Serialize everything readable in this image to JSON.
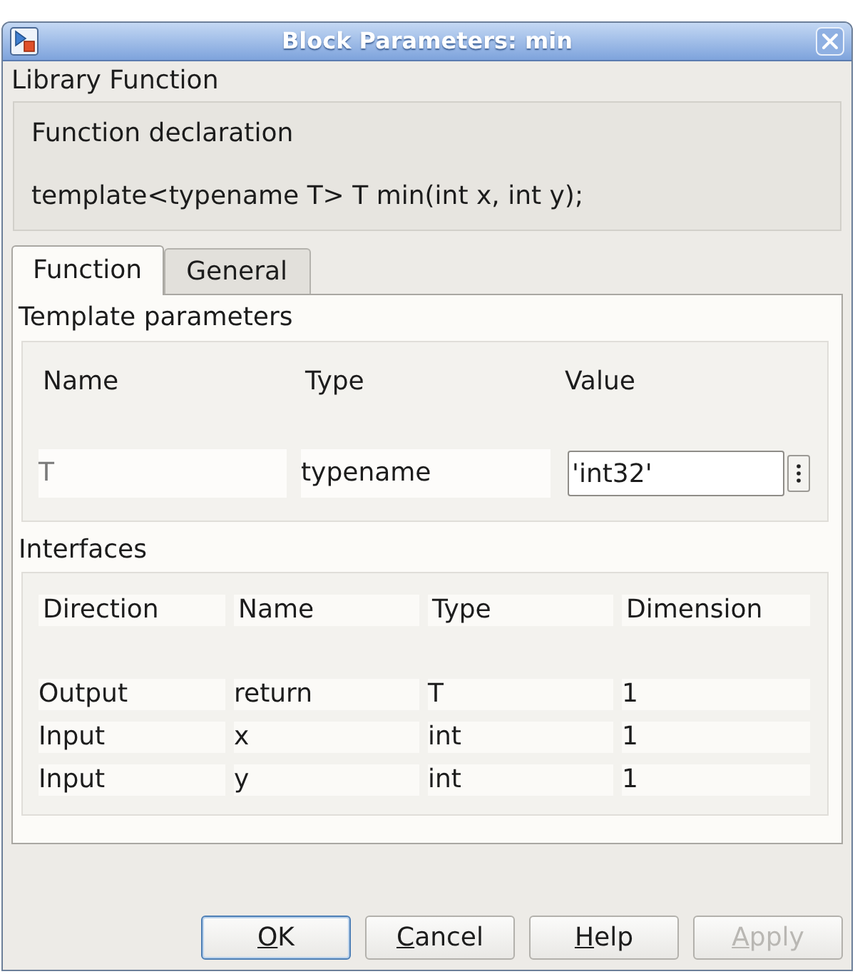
{
  "window": {
    "title": "Block Parameters: min"
  },
  "section_title": "Library Function",
  "declaration": {
    "label": "Function declaration",
    "code": "template<typename T> T min(int x, int y);"
  },
  "tabs": [
    {
      "label": "Function",
      "selected": true
    },
    {
      "label": "General",
      "selected": false
    }
  ],
  "template_parameters": {
    "title": "Template parameters",
    "columns": [
      "Name",
      "Type",
      "Value"
    ],
    "rows": [
      {
        "name": "T",
        "type": "typename",
        "value": "'int32'"
      }
    ]
  },
  "interfaces": {
    "title": "Interfaces",
    "columns": [
      "Direction",
      "Name",
      "Type",
      "Dimension"
    ],
    "rows": [
      [
        "Output",
        "return",
        "T",
        "1"
      ],
      [
        "Input",
        "x",
        "int",
        "1"
      ],
      [
        "Input",
        "y",
        "int",
        "1"
      ]
    ]
  },
  "buttons": [
    {
      "label": "OK",
      "focused": true,
      "disabled": false
    },
    {
      "label": "Cancel",
      "focused": false,
      "disabled": false
    },
    {
      "label": "Help",
      "focused": false,
      "disabled": false
    },
    {
      "label": "Apply",
      "focused": false,
      "disabled": true
    }
  ]
}
